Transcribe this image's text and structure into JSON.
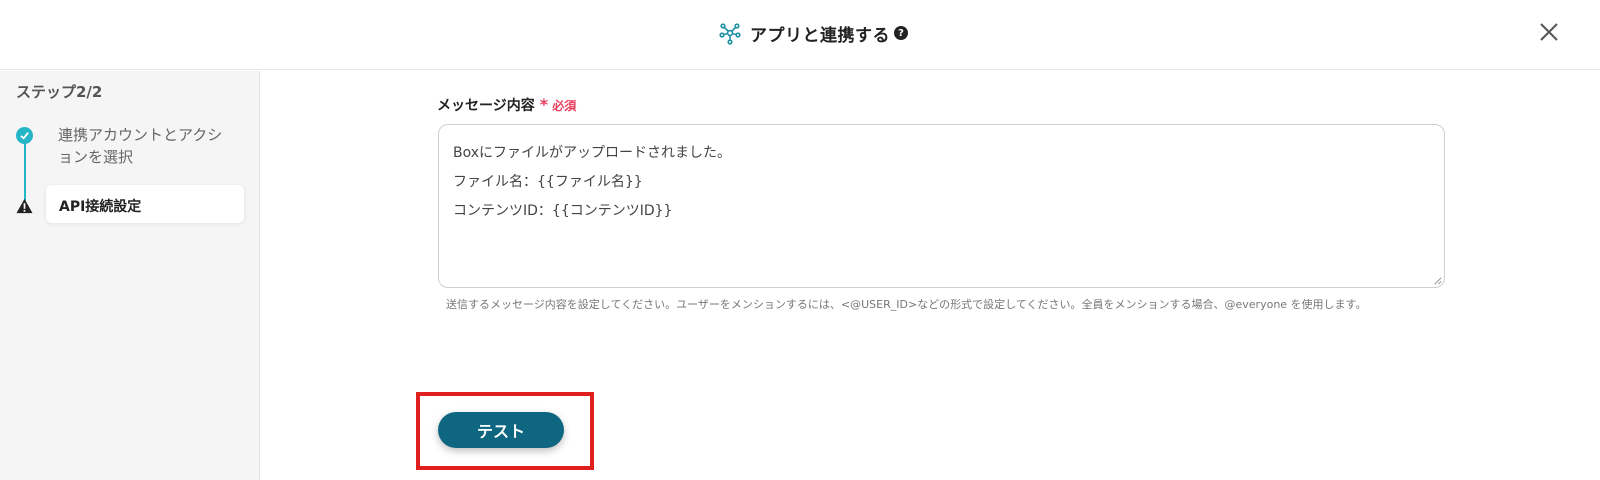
{
  "header": {
    "title": "アプリと連携する",
    "help_glyph": "?",
    "app_icon": "network-icon",
    "close_icon": "close-icon"
  },
  "sidebar": {
    "step_title": "ステップ2/2",
    "steps": [
      {
        "label": "連携アカウントとアクションを選択",
        "status": "completed",
        "icon": "check-icon"
      },
      {
        "label": "API接続設定",
        "status": "current",
        "icon": "warning-icon"
      }
    ]
  },
  "form": {
    "message_label": "メッセージ内容",
    "required_star": "*",
    "required_label": "必須",
    "message_lines": [
      "Boxにファイルがアップロードされました。",
      "ファイル名：{{ファイル名}}",
      "コンテンツID：{{コンテンツID}}"
    ],
    "help_text": "送信するメッセージ内容を設定してください。ユーザーをメンションするには、<@USER_ID>などの形式で設定してください。全員をメンションする場合、@everyone を使用します。"
  },
  "actions": {
    "test_label": "テスト"
  },
  "colors": {
    "accent": "#26b5c7",
    "primary_button": "#0e6680",
    "required": "#e83e5c",
    "highlight": "#e01f1f"
  }
}
